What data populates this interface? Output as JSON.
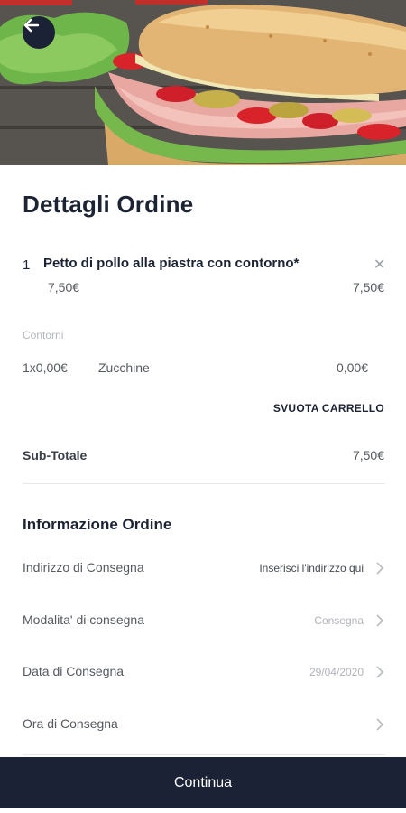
{
  "colors": {
    "primary_dark": "#1b2236",
    "text_primary": "#1c2333",
    "text_muted": "#b0b4ba",
    "text_secondary": "#555a62"
  },
  "header": {
    "back_icon": "arrow-left-icon",
    "hero_image": "sandwich-photo"
  },
  "order": {
    "title": "Dettagli Ordine",
    "item": {
      "quantity": "1",
      "name": "Petto di pollo alla piastra con contorno*",
      "unit_price": "7,50€",
      "total_price": "7,50€",
      "remove_icon": "close-icon"
    },
    "sides": {
      "label": "Contorni",
      "qty_price": "1x0,00€",
      "name": "Zucchine",
      "price": "0,00€"
    },
    "empty_cart_label": "SVUOTA CARRELLO",
    "subtotal_label": "Sub-Totale",
    "subtotal_value": "7,50€"
  },
  "info": {
    "title": "Informazione Ordine",
    "rows": [
      {
        "label": "Indirizzo di Consegna",
        "value": "Inserisci l'indirizzo qui",
        "icon": "chevron-right-icon"
      },
      {
        "label": "Modalita' di consegna",
        "value": "Consegna",
        "icon": "chevron-right-icon"
      },
      {
        "label": "Data di Consegna",
        "value": "29/04/2020",
        "icon": "chevron-right-icon"
      },
      {
        "label": "Ora di Consegna",
        "value": "",
        "icon": "chevron-right-icon"
      }
    ]
  },
  "footer": {
    "continue_label": "Continua"
  }
}
